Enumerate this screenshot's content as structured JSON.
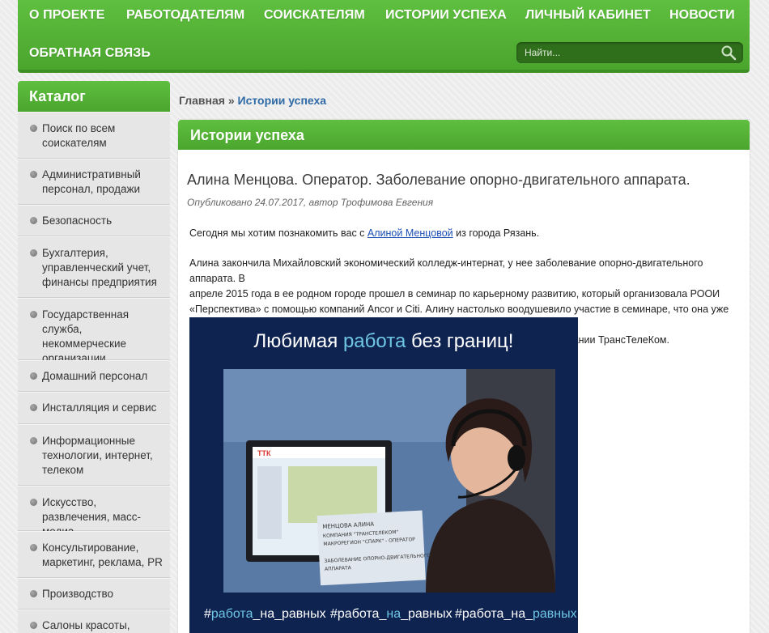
{
  "nav": {
    "items": [
      "О ПРОЕКТЕ",
      "РАБОТОДАТЕЛЯМ",
      "СОИСКАТЕЛЯМ",
      "ИСТОРИИ УСПЕХА",
      "ЛИЧНЫЙ КАБИНЕТ",
      "НОВОСТИ",
      "ОБРАТНАЯ СВЯЗЬ"
    ],
    "search_placeholder": "Найти..."
  },
  "sidebar": {
    "title": "Каталог",
    "items": [
      "Поиск по всем соискателям",
      "Административный персонал, продажи",
      "Безопасность",
      "Бухгалтерия, управленческий учет, финансы предприятия",
      "Государственная служба, некоммерческие организации",
      "Домашний персонал",
      "Инсталляция и сервис",
      "Информационные технологии, интернет, телеком",
      "Искусство, развлечения, масс-медиа",
      "Консультирование, маркетинг, реклама, PR",
      "Производство",
      "Салоны красоты,"
    ]
  },
  "breadcrumb": {
    "home": "Главная",
    "separator": " » ",
    "current": "Истории успеха"
  },
  "content": {
    "heading": "Истории успеха",
    "title": "Алина Менцова. Оператор. Заболевание опорно-двигательного аппарата.",
    "meta": "Опубликовано 24.07.2017, автор Трофимова Евгения",
    "intro_before": "Сегодня мы хотим познакомить вас с ",
    "intro_link": "Алиной Менцовой",
    "intro_after": " из города Рязань.",
    "body_lines": [
      "Алина закончила Михайловский экономический колледж-интернат, у нее заболевание опорно-двигательного аппарата. В",
      "апреле 2015 года в ее родном городе прошел в семинар по карьерному развитию, который организовала РООИ",
      "«Перспектива» с помощью компаний Ancor и Citi. Алину настолько воодушевило участие в семинаре, что она уже через пару",
      "месяцев нашла постоянную работу. Сейчас девушка – оператор call-центра компании ТрансТелеКом."
    ]
  },
  "image": {
    "headline_before": "Любимая ",
    "headline_accent": "работа",
    "headline_after": " без границ!",
    "screen_logo": "ТТК",
    "sign_lines": [
      "МЕНЦОВА АЛИНА",
      "КОМПАНИЯ \"ТРАНСТЕЛЕКОМ\"",
      "МАКРОРЕГИОН \"СПАРК\" - ОПЕРАТОР",
      "ЗАБОЛЕВАНИЕ ОПОРНО-ДВИГАТЕЛЬНОГО",
      "АППАРАТА"
    ],
    "hashtags": [
      {
        "a": "#",
        "b": "работа",
        "c": "_на_равных"
      },
      {
        "a": "#работа_",
        "b": "на",
        "c": "_равных"
      },
      {
        "a": "#работа_на_",
        "b": "равных",
        "c": ""
      }
    ]
  },
  "colors": {
    "brand_green": "#4aa52d",
    "link_blue": "#1a4fb3",
    "image_bg": "#0f2350",
    "accent_cyan": "#6fc6e4"
  }
}
